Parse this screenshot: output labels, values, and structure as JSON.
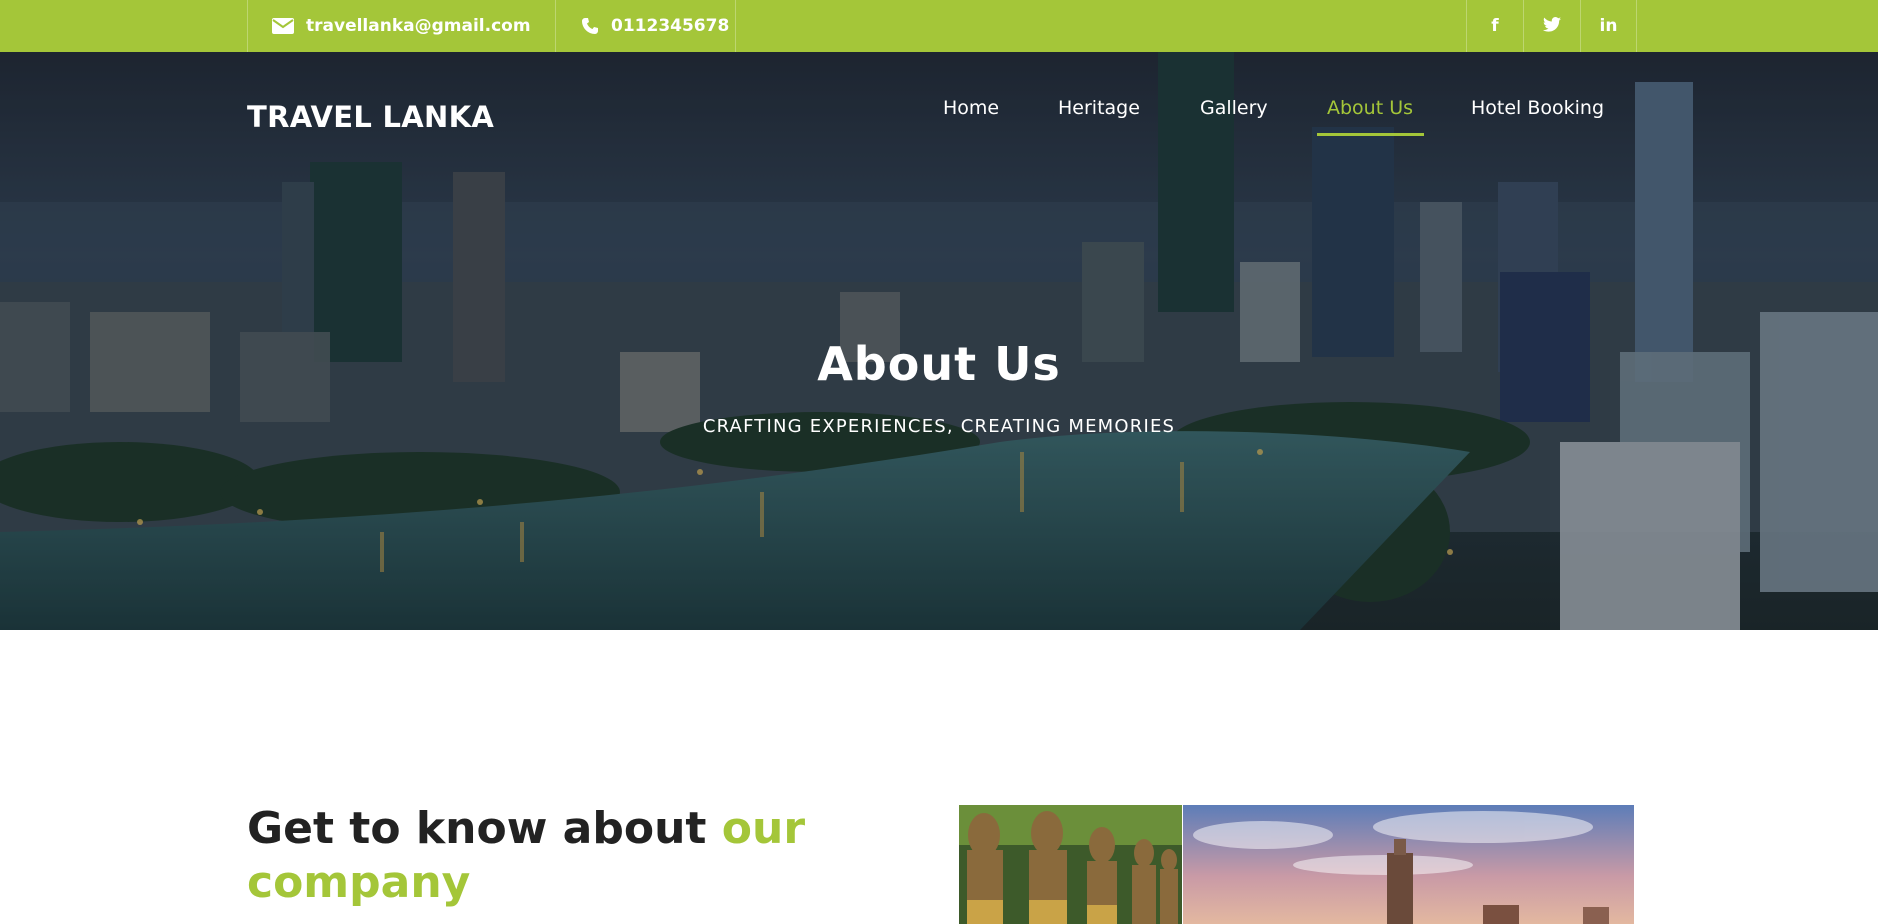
{
  "topbar": {
    "email": "travellanka@gmail.com",
    "phone": "0112345678",
    "social": {
      "facebook": "f",
      "linkedin": "in"
    }
  },
  "header": {
    "logo": "TRAVEL LANKA",
    "nav": [
      {
        "label": "Home"
      },
      {
        "label": "Heritage"
      },
      {
        "label": "Gallery"
      },
      {
        "label": "About Us",
        "active": true
      },
      {
        "label": "Hotel Booking"
      }
    ]
  },
  "hero": {
    "title": "About Us",
    "subtitle": "CRAFTING EXPERIENCES, CREATING MEMORIES"
  },
  "about": {
    "heading_part1": "Get to know about ",
    "heading_part2": "our company"
  },
  "icons": {
    "email": "envelope-icon",
    "phone": "phone-icon",
    "facebook": "facebook-icon",
    "twitter": "twitter-icon",
    "linkedin": "linkedin-icon"
  },
  "colors": {
    "accent": "#a4c639",
    "heading": "#222222"
  }
}
